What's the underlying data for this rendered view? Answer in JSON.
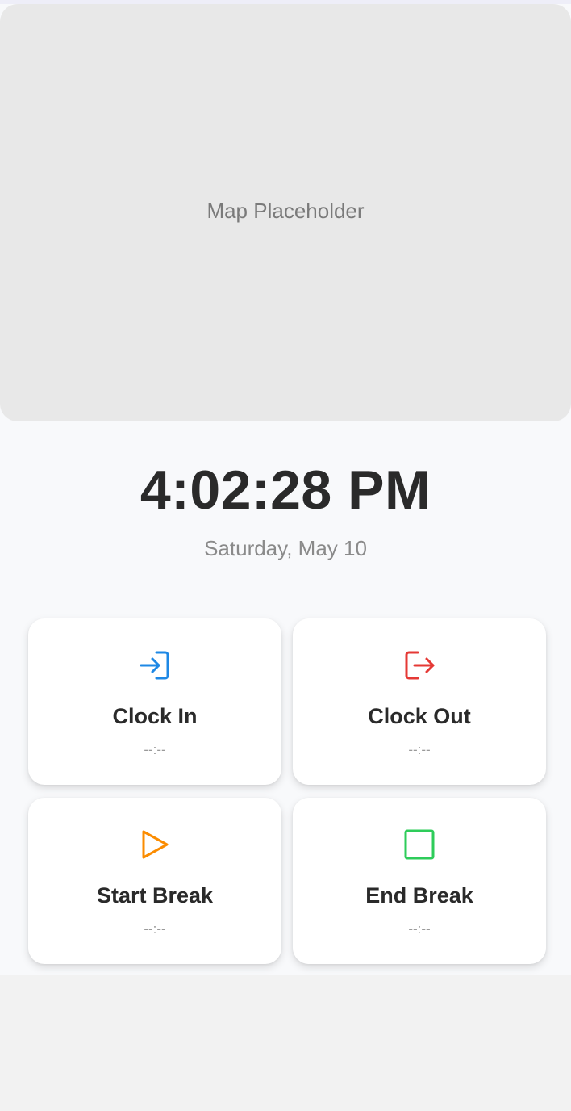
{
  "map": {
    "placeholder_label": "Map Placeholder"
  },
  "clock": {
    "time": "4:02:28 PM",
    "date": "Saturday, May 10"
  },
  "actions": [
    {
      "label": "Clock In",
      "time": "--:--",
      "icon": "login-icon",
      "color": "#1e88e5"
    },
    {
      "label": "Clock Out",
      "time": "--:--",
      "icon": "logout-icon",
      "color": "#e53935"
    },
    {
      "label": "Start Break",
      "time": "--:--",
      "icon": "play-icon",
      "color": "#fb8c00"
    },
    {
      "label": "End Break",
      "time": "--:--",
      "icon": "stop-icon",
      "color": "#2ecc5a"
    }
  ],
  "colors": {
    "background": "#f8f9fb",
    "map_background": "#e8e8e8",
    "text_primary": "#2a2a2a",
    "text_secondary": "#8a8a8a"
  }
}
